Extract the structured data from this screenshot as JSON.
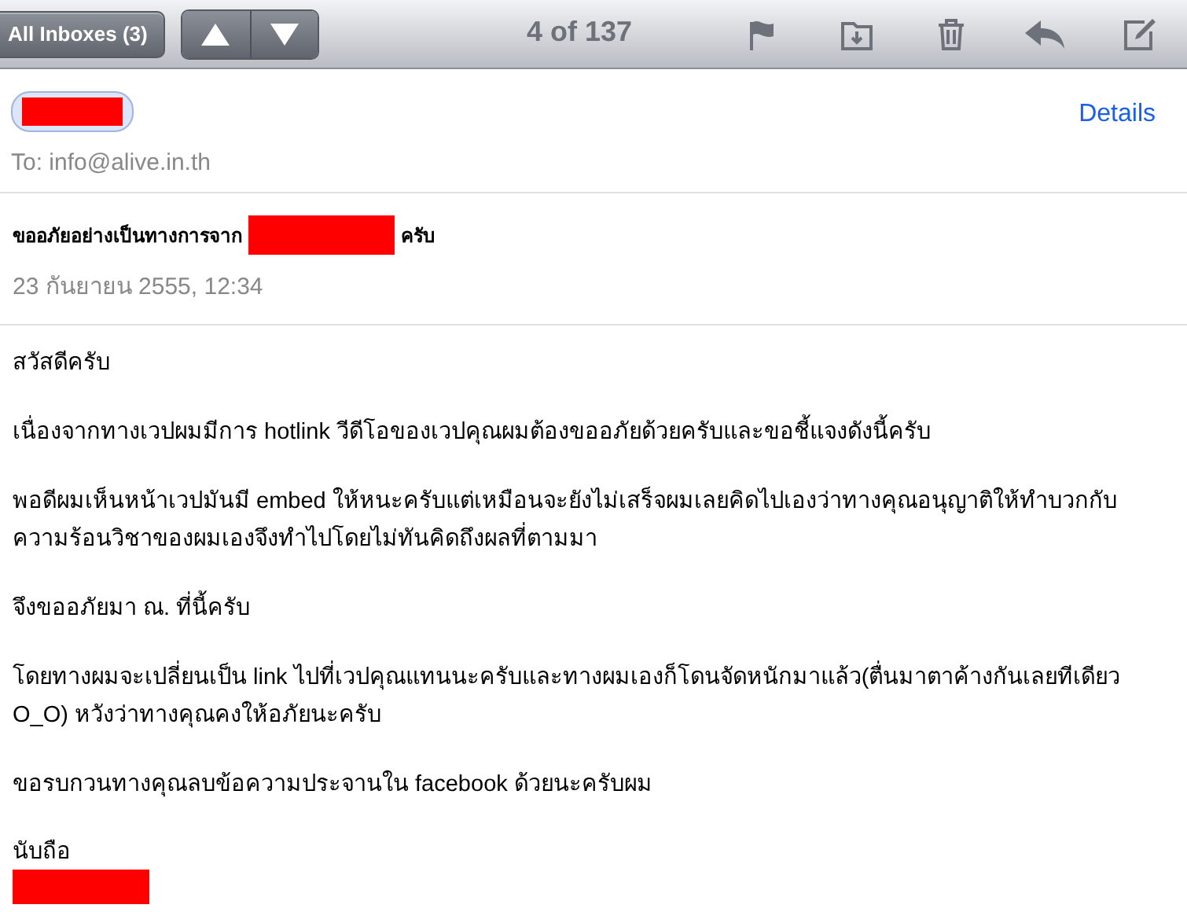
{
  "toolbar": {
    "back_button": "All Inboxes (3)",
    "counter": "4 of 137"
  },
  "header": {
    "to": "To: info@alive.in.th",
    "details_link": "Details"
  },
  "subject": {
    "before": "ขออภัยอย่างเป็นทางการจาก",
    "after": "ครับ",
    "date": "23 กันยายน 2555, 12:34"
  },
  "body": {
    "paragraphs": [
      "สวัสดีครับ",
      "เนื่องจากทางเวปผมมีการ hotlink วีดีโอของเวปคุณผมต้องขออภัยด้วยครับและขอชี้แจงดังนี้ครับ",
      "พอดีผมเห็นหน้าเวปมันมี embed ให้หนะครับแต่เหมือนจะยังไม่เสร็จผมเลยคิดไปเองว่าทางคุณอนุญาติให้ทำบวกกับความร้อนวิชาของผมเองจึงทำไปโดยไม่ทันคิดถึงผลที่ตามมา",
      "จึงขออภัยมา ณ. ที่นี้ครับ",
      "โดยทางผมจะเปลี่ยนเป็น link ไปที่เวปคุณแทนนะครับและทางผมเองก็โดนจัดหนักมาแล้ว(ตื่นมาตาค้างกันเลยทีเดียว O_O) หวังว่าทางคุณคงให้อภัยนะครับ",
      "ขอรบกวนทางคุณลบข้อความประจานใน facebook ด้วยนะครับผม"
    ],
    "signoff": "นับถือ"
  }
}
